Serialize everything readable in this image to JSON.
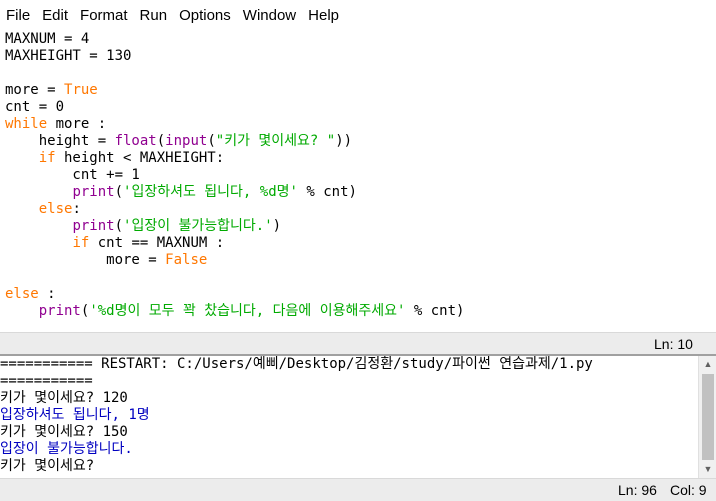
{
  "menu": {
    "file": "File",
    "edit": "Edit",
    "format": "Format",
    "run": "Run",
    "options": "Options",
    "window": "Window",
    "help": "Help"
  },
  "editor": {
    "lines": [
      [
        {
          "t": "MAXNUM = 4",
          "c": ""
        }
      ],
      [
        {
          "t": "MAXHEIGHT = 130",
          "c": ""
        }
      ],
      [
        {
          "t": "",
          "c": ""
        }
      ],
      [
        {
          "t": "more = ",
          "c": ""
        },
        {
          "t": "True",
          "c": "kw"
        }
      ],
      [
        {
          "t": "cnt = 0",
          "c": ""
        }
      ],
      [
        {
          "t": "while",
          "c": "kw"
        },
        {
          "t": " more :",
          "c": ""
        }
      ],
      [
        {
          "t": "    height = ",
          "c": ""
        },
        {
          "t": "float",
          "c": "bi"
        },
        {
          "t": "(",
          "c": ""
        },
        {
          "t": "input",
          "c": "bi"
        },
        {
          "t": "(",
          "c": ""
        },
        {
          "t": "\"키가 몇이세요? \"",
          "c": "str"
        },
        {
          "t": "))",
          "c": ""
        }
      ],
      [
        {
          "t": "    ",
          "c": ""
        },
        {
          "t": "if",
          "c": "kw"
        },
        {
          "t": " height < MAXHEIGHT:",
          "c": ""
        }
      ],
      [
        {
          "t": "        cnt += 1",
          "c": ""
        }
      ],
      [
        {
          "t": "        ",
          "c": ""
        },
        {
          "t": "print",
          "c": "bi"
        },
        {
          "t": "(",
          "c": ""
        },
        {
          "t": "'입장하셔도 됩니다, %d명'",
          "c": "str"
        },
        {
          "t": " % cnt)",
          "c": ""
        }
      ],
      [
        {
          "t": "    ",
          "c": ""
        },
        {
          "t": "else",
          "c": "kw"
        },
        {
          "t": ":",
          "c": ""
        }
      ],
      [
        {
          "t": "        ",
          "c": ""
        },
        {
          "t": "print",
          "c": "bi"
        },
        {
          "t": "(",
          "c": ""
        },
        {
          "t": "'입장이 불가능합니다.'",
          "c": "str"
        },
        {
          "t": ")",
          "c": ""
        }
      ],
      [
        {
          "t": "        ",
          "c": ""
        },
        {
          "t": "if",
          "c": "kw"
        },
        {
          "t": " cnt == MAXNUM :",
          "c": ""
        }
      ],
      [
        {
          "t": "            more = ",
          "c": ""
        },
        {
          "t": "False",
          "c": "kw"
        }
      ],
      [
        {
          "t": "",
          "c": ""
        }
      ],
      [
        {
          "t": "else",
          "c": "kw"
        },
        {
          "t": " :",
          "c": ""
        }
      ],
      [
        {
          "t": "    ",
          "c": ""
        },
        {
          "t": "print",
          "c": "bi"
        },
        {
          "t": "(",
          "c": ""
        },
        {
          "t": "'%d명이 모두 꽉 찼습니다, 다음에 이용해주세요'",
          "c": "str"
        },
        {
          "t": " % cnt)",
          "c": ""
        }
      ]
    ]
  },
  "editor_status": {
    "position": "Ln: 10"
  },
  "shell": {
    "lines": [
      {
        "t": "=========== RESTART: C:/Users/예삐/Desktop/김정환/study/파이썬 연습과제/1.py",
        "c": "out-sys"
      },
      {
        "t": "===========",
        "c": "out-sys"
      },
      {
        "t": "키가 몇이세요? 120",
        "c": "out-sys"
      },
      {
        "t": "입장하셔도 됩니다, 1명",
        "c": "out-blue"
      },
      {
        "t": "키가 몇이세요? 150",
        "c": "out-sys"
      },
      {
        "t": "입장이 불가능합니다.",
        "c": "out-blue"
      },
      {
        "t": "키가 몇이세요? ",
        "c": "out-sys"
      }
    ]
  },
  "shell_status": {
    "line": "Ln: 96",
    "col": "Col: 9"
  }
}
